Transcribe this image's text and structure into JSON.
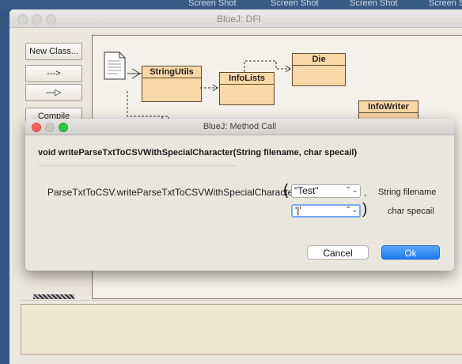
{
  "desktop": {
    "labels": [
      "Screen Shot",
      "Screen Shot",
      "Screen Shot",
      "Screen S"
    ]
  },
  "main_window": {
    "title": "BlueJ:  DFI",
    "side_buttons": {
      "new_class": "New Class...",
      "dependency_arrow": "--->",
      "inheritance_arrow": "—▷",
      "compile": "Compile"
    },
    "classes": {
      "string_utils": "StringUtils",
      "info_lists": "InfoLists",
      "die": "Die",
      "info_writer": "InfoWriter"
    }
  },
  "dialog": {
    "title": "BlueJ:  Method Call",
    "signature": "void writeParseTxtToCSVWithSpecialCharacter(String filename, char specail)",
    "call": "ParseTxtToCSV.writeParseTxtToCSVWithSpecialCharacter",
    "open_paren": "(",
    "close_paren": ")",
    "comma": ",",
    "args": [
      {
        "value": "\"Test\"",
        "label": "String filename"
      },
      {
        "value": "'|'",
        "label": "char specail"
      }
    ],
    "cancel_label": "Cancel",
    "ok_label": "Ok"
  },
  "colors": {
    "class_fill": "#fad7a6",
    "ok_button": "#1a7af2",
    "close_red": "#fc5f57",
    "zoom_green": "#2acb42"
  }
}
